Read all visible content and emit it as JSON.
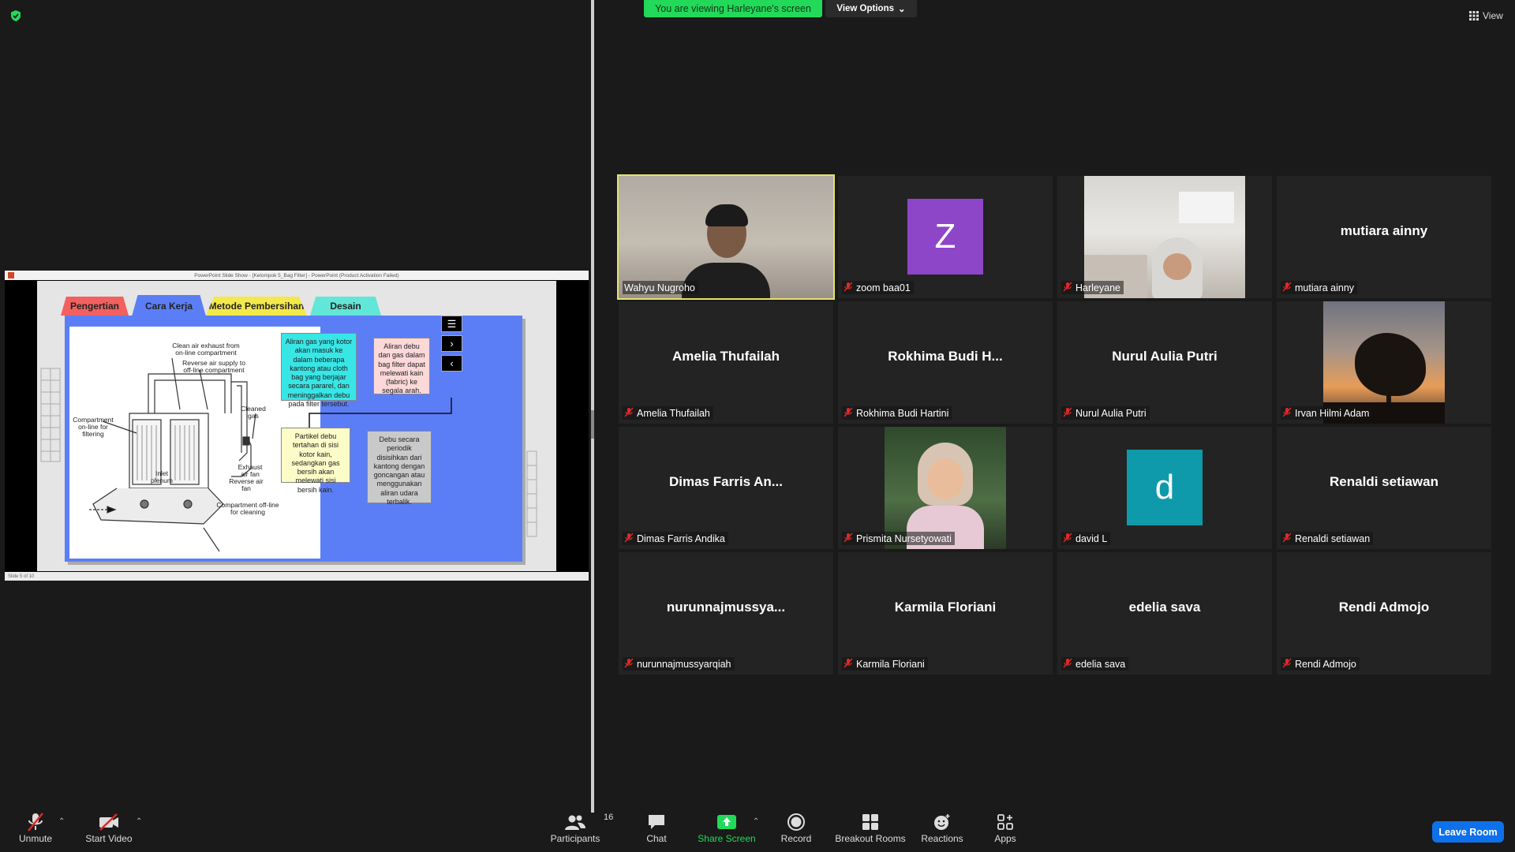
{
  "banner": {
    "viewing_text": "You are viewing Harleyane's screen",
    "view_options": "View Options"
  },
  "view_button": "View",
  "share": {
    "title_bar": "PowerPoint Slide Show - [Kelompok 5_Bag Filter] - PowerPoint (Product Activation Failed)",
    "status": "Slide 5 of 10",
    "tabs": [
      "Pengertian",
      "Cara Kerja",
      "Metode Pembersihan",
      "Desain"
    ],
    "diagram_labels": {
      "clean_air": "Clean air exhaust from\non-line compartment",
      "reverse_supply": "Reverse air supply to\noff-line compartment",
      "compartment_online": "Compartment\non-line for\nfiltering",
      "cleaned_gas": "Cleaned\ngas",
      "inlet": "Inlet\nplenum",
      "exhaust": "Exhaust\nair fan",
      "reverse_fan": "Reverse air\nfan",
      "compartment_offline": "Compartment off-line\nfor cleaning"
    },
    "boxes": [
      "Aliran gas yang kotor akan masuk ke dalam beberapa  kantong atau cloth bag yang berjajar secara  pararel, dan meninggalkan debu pada filter tersebut.",
      "Aliran debu dan gas dalam bag filter dapat melewati kain (fabric) ke segala arah.",
      "Partikel debu tertahan di sisi  kotor kain, sedangkan gas bersih akan melewati sisi bersih kain.",
      "Debu secara periodik disisihkan dari kantong dengan goncangan atau menggunakan aliran udara terbalik."
    ]
  },
  "participants": [
    {
      "big": "",
      "label": "Wahyu Nugroho"
    },
    {
      "big": "Z",
      "label": "zoom baa01",
      "color": "#8e46c8"
    },
    {
      "big": "",
      "label": "Harleyane"
    },
    {
      "big": "mutiara ainny",
      "label": "mutiara ainny"
    },
    {
      "big": "Amelia Thufailah",
      "label": "Amelia Thufailah"
    },
    {
      "big": "Rokhima  Budi  H...",
      "label": "Rokhima Budi Hartini"
    },
    {
      "big": "Nurul Aulia Putri",
      "label": "Nurul Aulia Putri"
    },
    {
      "big": "",
      "label": "Irvan Hilmi Adam"
    },
    {
      "big": "Dimas  Farris  An...",
      "label": "Dimas Farris Andika"
    },
    {
      "big": "",
      "label": "Prismita Nursetyowati"
    },
    {
      "big": "d",
      "label": "david L",
      "color": "#0f9aab"
    },
    {
      "big": "Renaldi setiawan",
      "label": "Renaldi setiawan"
    },
    {
      "big": "nurunnajmussya...",
      "label": "nurunnajmussyarqiah"
    },
    {
      "big": "Karmila Floriani",
      "label": "Karmila Floriani"
    },
    {
      "big": "edelia sava",
      "label": "edelia sava"
    },
    {
      "big": "Rendi Admojo",
      "label": "Rendi Admojo"
    }
  ],
  "toolbar": {
    "unmute": "Unmute",
    "start_video": "Start Video",
    "participants": "Participants",
    "participant_count": "16",
    "chat": "Chat",
    "share_screen": "Share Screen",
    "record": "Record",
    "breakout": "Breakout Rooms",
    "reactions": "Reactions",
    "apps": "Apps",
    "leave": "Leave Room"
  },
  "colors": {
    "active_speaker": "#e3e36b",
    "share_green": "#23d959",
    "leave_blue": "#0e71eb",
    "muted_red": "#e02828"
  }
}
